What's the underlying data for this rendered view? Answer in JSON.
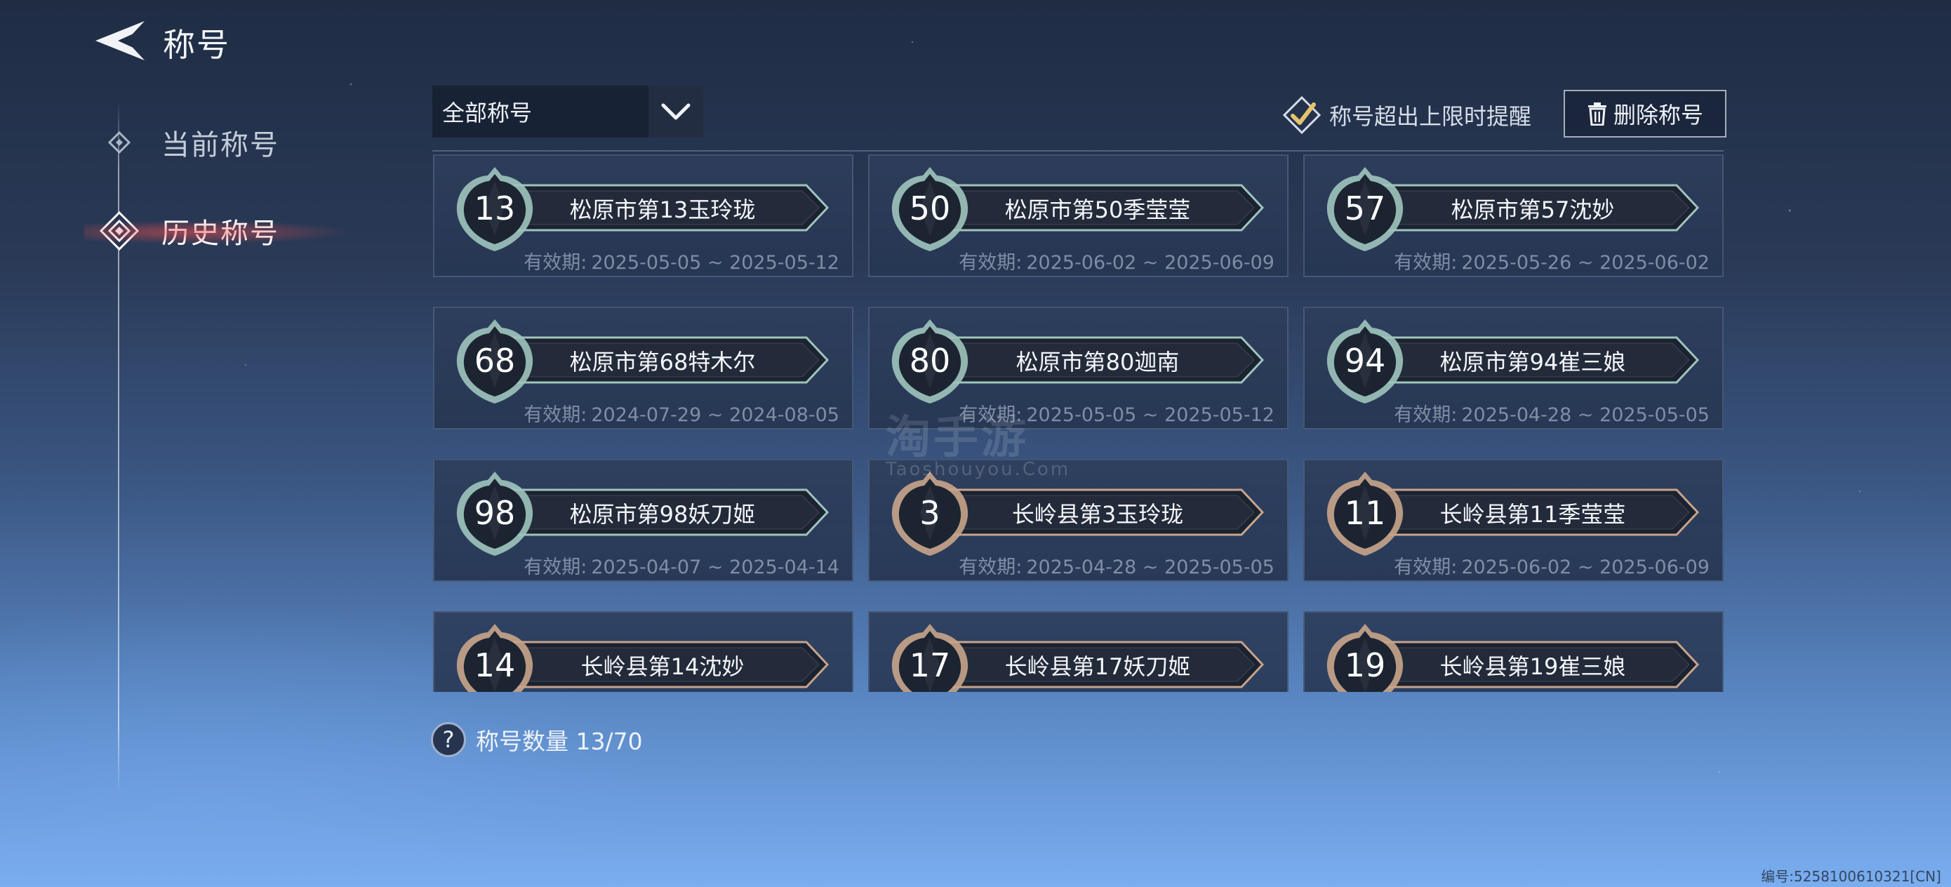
{
  "header": {
    "title": "称号",
    "back_icon": "back-arrow-icon"
  },
  "nav": {
    "items": [
      {
        "label": "当前称号",
        "icon": "diamond-icon",
        "active": false
      },
      {
        "label": "历史称号",
        "icon": "diamond-icon",
        "active": true
      }
    ]
  },
  "filter": {
    "selected": "全部称号",
    "icon": "chevron-down-icon"
  },
  "reminder": {
    "label": "称号超出上限时提醒",
    "icon": "checkbox-icon",
    "checked": true
  },
  "delete_button": {
    "label": "删除称号",
    "icon": "trash-icon"
  },
  "validity_label": "有效期:",
  "titles": [
    {
      "rank": "13",
      "name": "松原市第13玉玲珑",
      "validity": "2025-05-05 ~ 2025-05-12",
      "tier": "silver"
    },
    {
      "rank": "50",
      "name": "松原市第50季莹莹",
      "validity": "2025-06-02 ~ 2025-06-09",
      "tier": "silver"
    },
    {
      "rank": "57",
      "name": "松原市第57沈妙",
      "validity": "2025-05-26 ~ 2025-06-02",
      "tier": "silver"
    },
    {
      "rank": "68",
      "name": "松原市第68特木尔",
      "validity": "2024-07-29 ~ 2024-08-05",
      "tier": "silver"
    },
    {
      "rank": "80",
      "name": "松原市第80迦南",
      "validity": "2025-05-05 ~ 2025-05-12",
      "tier": "silver"
    },
    {
      "rank": "94",
      "name": "松原市第94崔三娘",
      "validity": "2025-04-28 ~ 2025-05-05",
      "tier": "silver"
    },
    {
      "rank": "98",
      "name": "松原市第98妖刀姬",
      "validity": "2025-04-07 ~ 2025-04-14",
      "tier": "silver"
    },
    {
      "rank": "3",
      "name": "长岭县第3玉玲珑",
      "validity": "2025-04-28 ~ 2025-05-05",
      "tier": "bronze"
    },
    {
      "rank": "11",
      "name": "长岭县第11季莹莹",
      "validity": "2025-06-02 ~ 2025-06-09",
      "tier": "bronze"
    },
    {
      "rank": "14",
      "name": "长岭县第14沈妙",
      "validity": "",
      "tier": "bronze"
    },
    {
      "rank": "17",
      "name": "长岭县第17妖刀姬",
      "validity": "",
      "tier": "bronze"
    },
    {
      "rank": "19",
      "name": "长岭县第19崔三娘",
      "validity": "",
      "tier": "bronze"
    }
  ],
  "count": {
    "label": "称号数量 13/70",
    "icon": "question-icon"
  },
  "watermark": {
    "text": "淘手游",
    "sub": "Taoshouyou.Com"
  },
  "serial": "编号:5258100610321[CN]",
  "colors": {
    "silver_rim": "#9fc4bd",
    "bronze_rim": "#c8a48a",
    "accent_gold": "#e6c46a",
    "nav_active_glow": "#f05050"
  }
}
